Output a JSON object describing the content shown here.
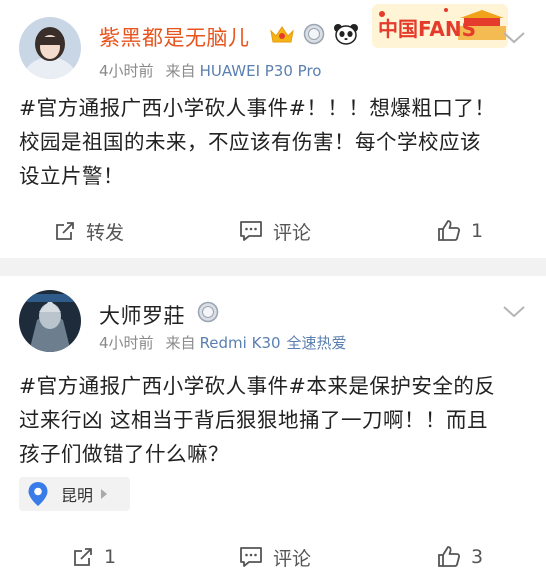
{
  "posts": [
    {
      "username": "紫黑都是无脑儿",
      "time": "4小时前",
      "source_label": "来自",
      "source_device": "HUAWEI P30 Pro",
      "fans_badge": "中国FANS",
      "content_lines": [
        "#官方通报广西小学砍人事件#！！！想爆粗口了！",
        "校园是祖国的未来，不应该有伤害！每个学校应该",
        "设立片警！"
      ],
      "actions": {
        "repost": "转发",
        "comment": "评论",
        "like": "1"
      }
    },
    {
      "username": "大师罗莊",
      "time": "4小时前",
      "source_label": "来自",
      "source_device": "Redmi K30",
      "source_extra": "全速热爱",
      "content_lines": [
        "#官方通报广西小学砍人事件#本来是保护安全的反",
        "过来行凶 这相当于背后狠狠地捅了一刀啊！！而且",
        "孩子们做错了什么嘛？"
      ],
      "location": "昆明",
      "actions": {
        "repost": "1",
        "comment": "评论",
        "like": "3"
      }
    }
  ],
  "colors": {
    "username_red": "#e8541d",
    "link_blue": "#5b7fb0",
    "meta_gray": "#8a8a8a",
    "fans_red": "#e53b2c",
    "location_blue": "#3a7bea"
  },
  "icons": [
    "crown-icon",
    "silver-medal-icon",
    "panda-icon",
    "chevron-down-icon",
    "repost-icon",
    "comment-icon",
    "like-icon",
    "location-pin-icon"
  ]
}
